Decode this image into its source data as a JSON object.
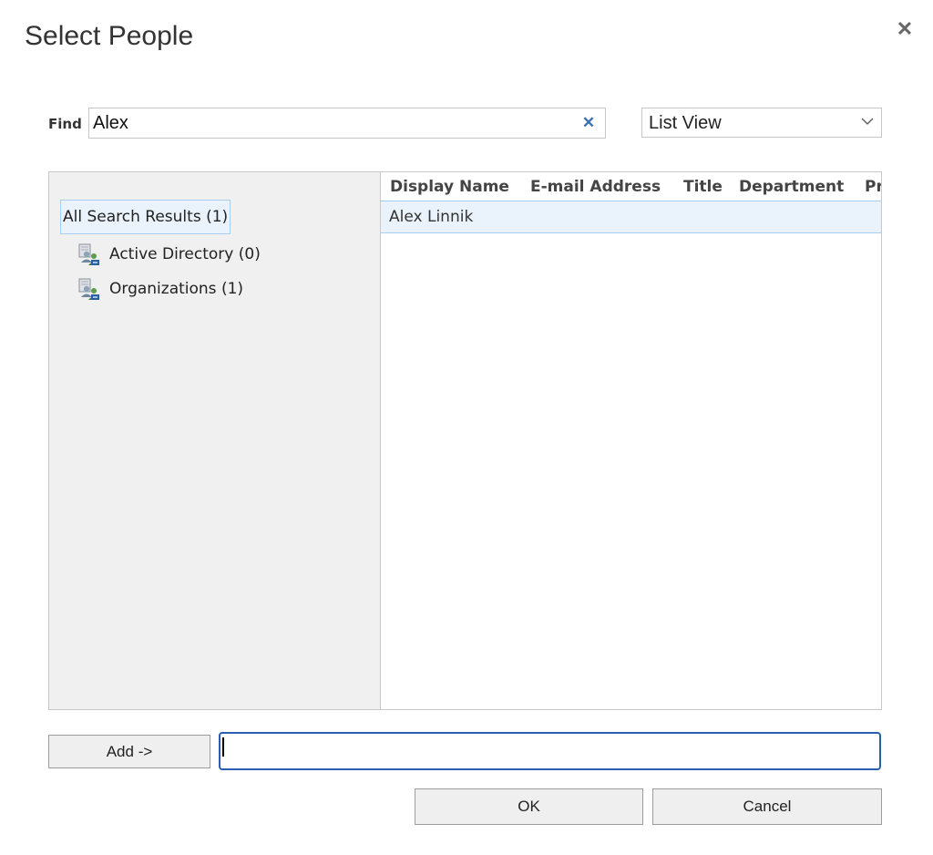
{
  "dialog": {
    "title": "Select People",
    "close_symbol": "✕"
  },
  "find": {
    "label": "Find",
    "value": "Alex",
    "clear_symbol": "✕"
  },
  "view_select": {
    "selected": "List View"
  },
  "tree": {
    "root": "All Search Results (1)",
    "items": [
      {
        "label": "Active Directory (0)",
        "icon": "directory-group-icon"
      },
      {
        "label": "Organizations (1)",
        "icon": "directory-group-icon"
      }
    ]
  },
  "grid": {
    "columns": [
      "Display Name",
      "E-mail Address",
      "Title",
      "Department",
      "Pr"
    ],
    "rows": [
      {
        "display_name": "Alex Linnik",
        "email": "",
        "title": "",
        "department": ""
      }
    ]
  },
  "actions": {
    "add_label": "Add ->",
    "selected_value": "",
    "ok_label": "OK",
    "cancel_label": "Cancel"
  },
  "colors": {
    "selection_bg": "#eaf3fb",
    "selection_border": "#a8cdee",
    "focus_border": "#2a5fb0",
    "clear_icon": "#3a6fb0"
  }
}
